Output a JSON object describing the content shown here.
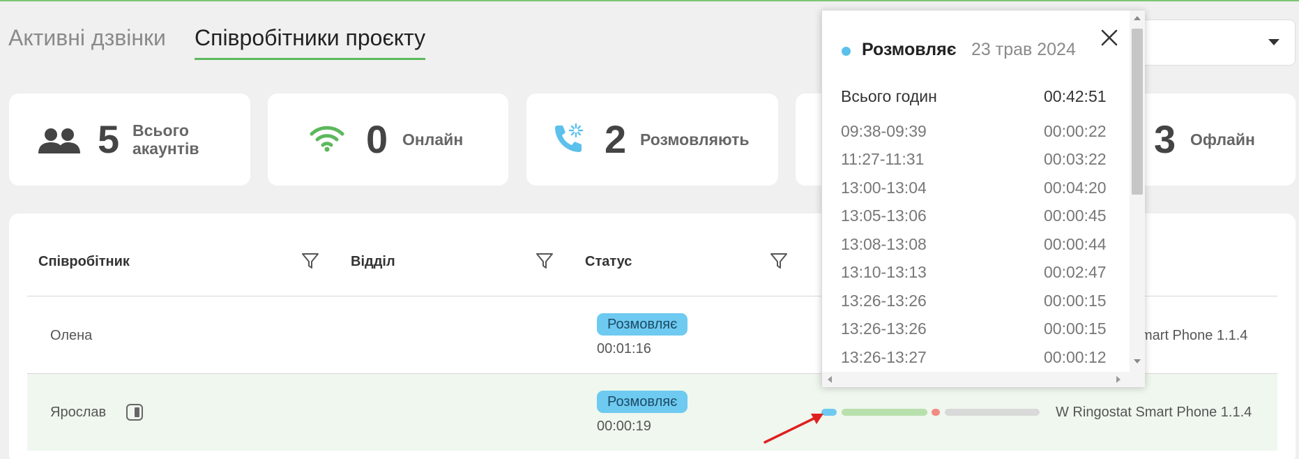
{
  "tabs": [
    {
      "label": "Активні дзвінки",
      "active": false
    },
    {
      "label": "Співробітники проєкту",
      "active": true
    }
  ],
  "stats": {
    "total": {
      "value": "5",
      "label_line1": "Всього",
      "label_line2": "акаунтів",
      "icon": "users-icon"
    },
    "online": {
      "value": "0",
      "label": "Онлайн",
      "icon": "wifi-icon"
    },
    "talking": {
      "value": "2",
      "label": "Розмовляють",
      "icon": "phone-ringing-icon"
    },
    "offline": {
      "value": "3",
      "label": "Офлайн"
    }
  },
  "table": {
    "headers": {
      "employee": "Співробітник",
      "department": "Відділ",
      "status": "Статус"
    },
    "rows": [
      {
        "name": "Олена",
        "status": "Розмовляє",
        "duration": "00:01:16",
        "device": "mart Phone 1.1.4"
      },
      {
        "name": "Ярослав",
        "status": "Розмовляє",
        "duration": "00:00:19",
        "device": "W Ringostat Smart Phone 1.1.4"
      }
    ]
  },
  "popup": {
    "status": "Розмовляє",
    "date": "23 трав 2024",
    "total_label": "Всього годин",
    "total_value": "00:42:51",
    "sessions": [
      {
        "time": "09:38-09:39",
        "duration": "00:00:22"
      },
      {
        "time": "11:27-11:31",
        "duration": "00:03:22"
      },
      {
        "time": "13:00-13:04",
        "duration": "00:04:20"
      },
      {
        "time": "13:05-13:06",
        "duration": "00:00:45"
      },
      {
        "time": "13:08-13:08",
        "duration": "00:00:44"
      },
      {
        "time": "13:10-13:13",
        "duration": "00:02:47"
      },
      {
        "time": "13:26-13:26",
        "duration": "00:00:15"
      },
      {
        "time": "13:26-13:26",
        "duration": "00:00:15"
      },
      {
        "time": "13:26-13:27",
        "duration": "00:00:12"
      }
    ]
  },
  "colors": {
    "accent_green": "#5cb85c",
    "talking_blue": "#6ecaf0",
    "online_green": "#7cc576",
    "missed_red": "#f28b82",
    "arrow_red": "#e02020"
  }
}
